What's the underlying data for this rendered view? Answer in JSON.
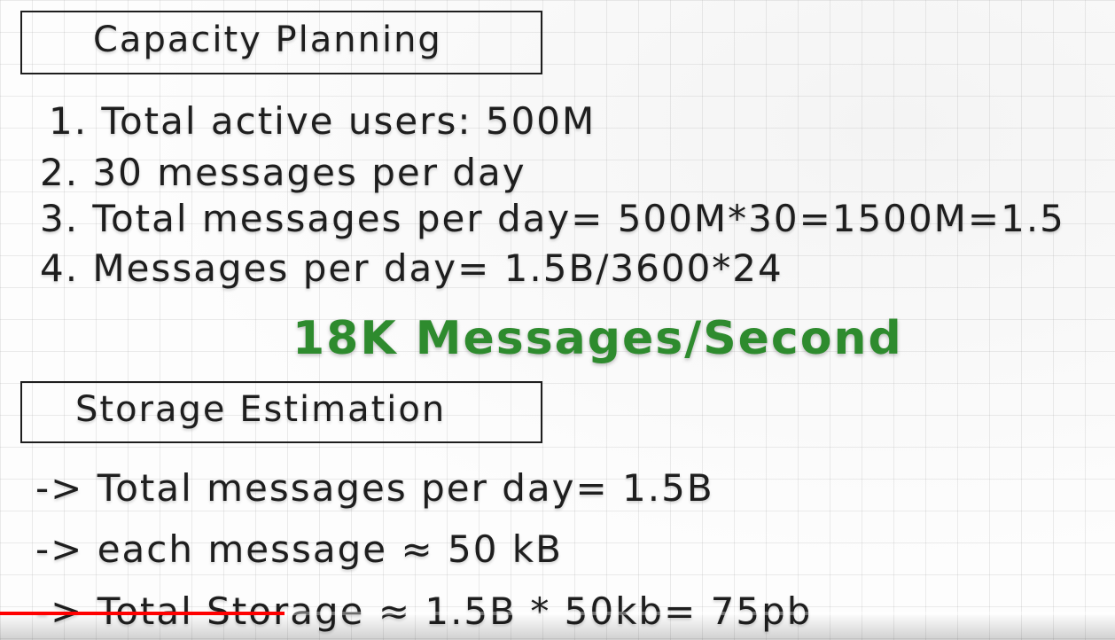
{
  "capacity_section": {
    "title": "Capacity Planning",
    "items": [
      "1. Total active users: 500M",
      "2. 30 messages per day",
      "3. Total messages per day= 500M*30=1500M=1.5",
      "4. Messages per day= 1.5B/3600*24"
    ],
    "result": "18K Messages/Second",
    "result_color": "#2e8b2e"
  },
  "storage_section": {
    "title": "Storage Estimation",
    "items": [
      "-> Total messages per day= 1.5B",
      "-> each message ≈ 50 kB",
      "-> Total Storage ≈ 1.5B * 50kb= 75pb"
    ]
  },
  "video_player": {
    "progress_fraction": 0.255,
    "progress_color": "#ff0000"
  }
}
